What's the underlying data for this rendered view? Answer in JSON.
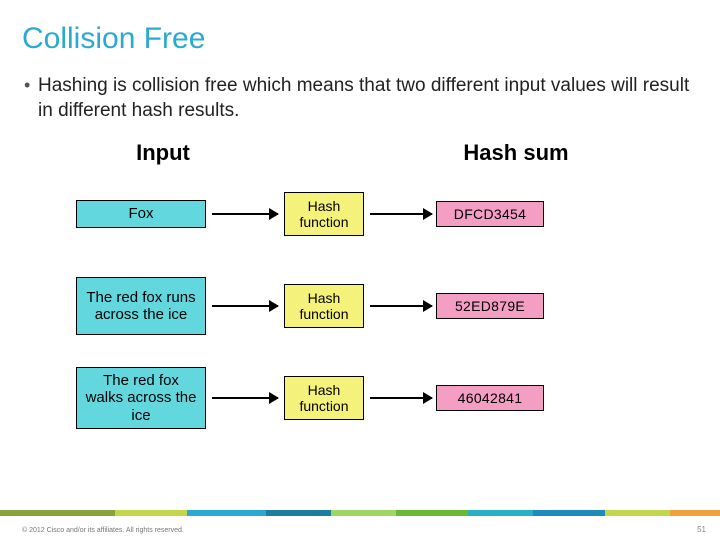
{
  "title": "Collision Free",
  "bullet": "Hashing is collision free which means that two different input values will result in different hash results.",
  "diagram": {
    "headers": {
      "input": "Input",
      "sum": "Hash sum"
    },
    "function_label": "Hash function",
    "rows": [
      {
        "input": "Fox",
        "tall": false,
        "hash": "DFCD3454"
      },
      {
        "input": "The red fox runs across the ice",
        "tall": true,
        "hash": "52ED879E"
      },
      {
        "input": "The red fox walks across the ice",
        "tall": true,
        "hash": "46042841"
      }
    ]
  },
  "footer": {
    "copyright": "© 2012 Cisco and/or its affiliates. All rights reserved.",
    "page": "51"
  }
}
